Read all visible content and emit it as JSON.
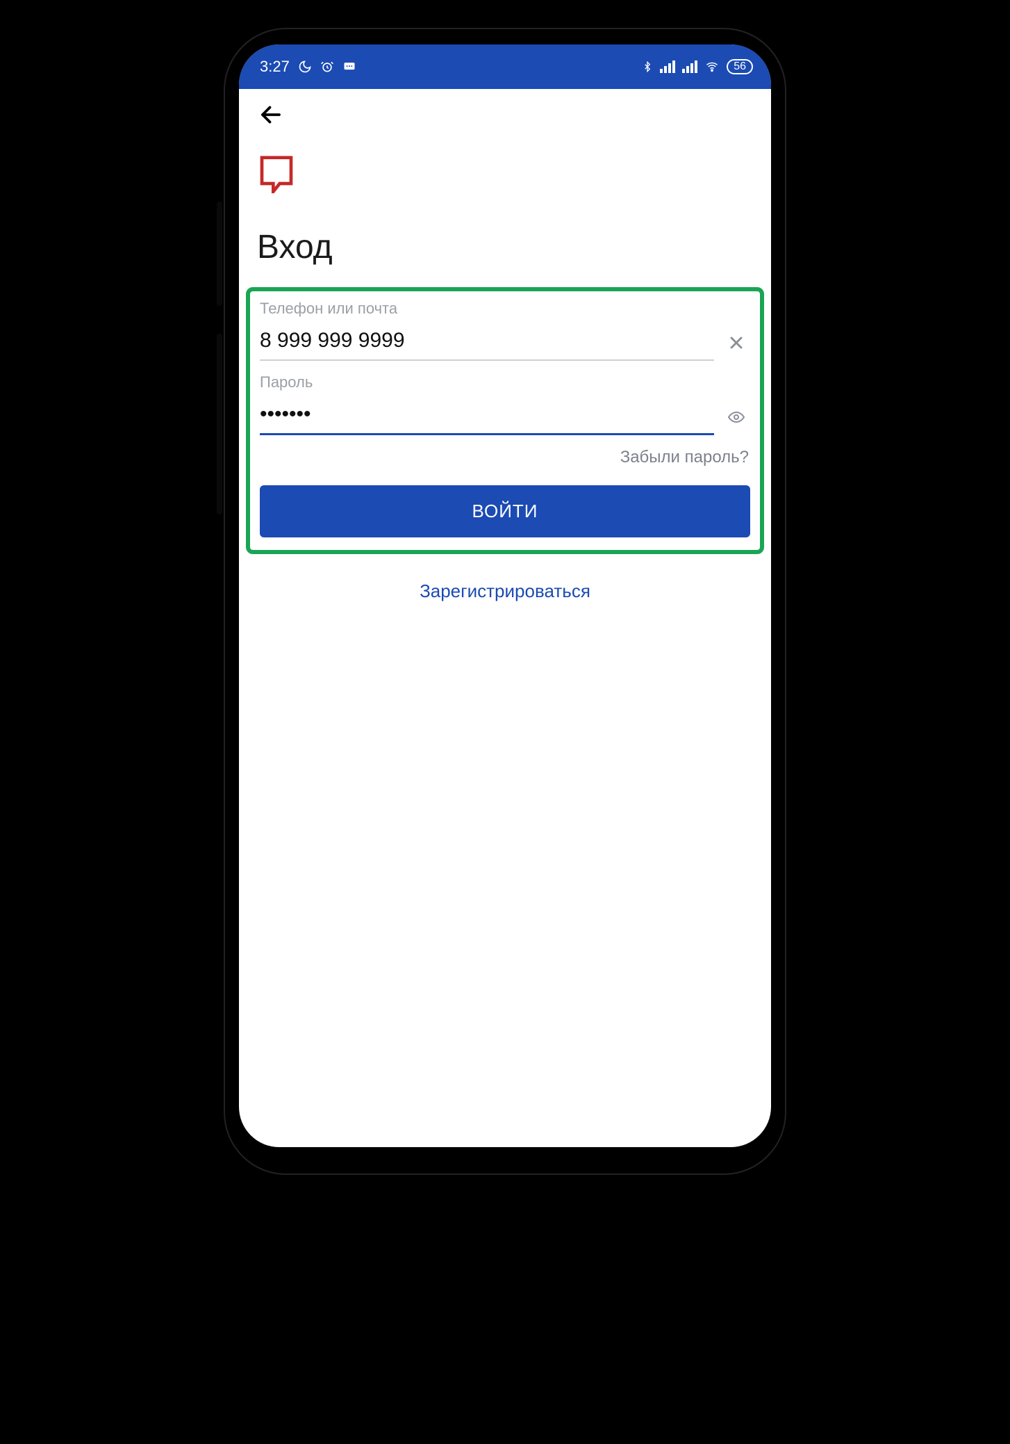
{
  "statusbar": {
    "time": "3:27",
    "battery": "56"
  },
  "page": {
    "title": "Вход"
  },
  "form": {
    "phone_label": "Телефон или почта",
    "phone_value": "8 999 999 9999",
    "password_label": "Пароль",
    "password_value": "•••••••",
    "forgot": "Забыли пароль?",
    "login_button": "ВОЙТИ"
  },
  "links": {
    "register": "Зарегистрироваться"
  }
}
